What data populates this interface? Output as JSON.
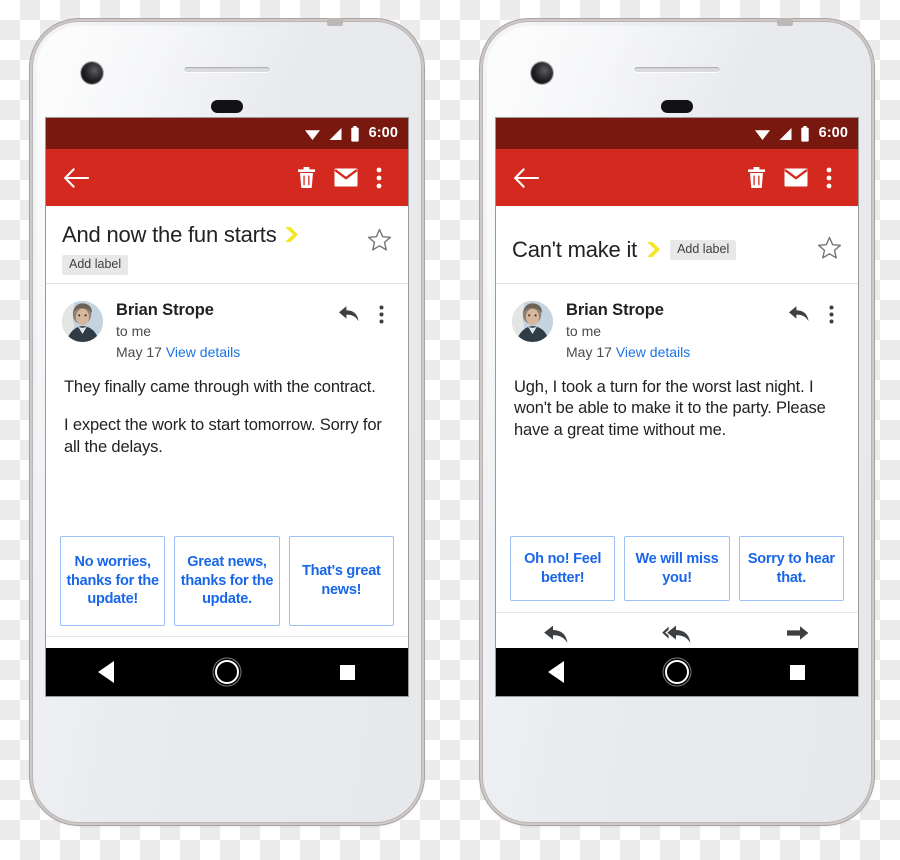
{
  "statusbar": {
    "time": "6:00",
    "icons": [
      "wifi-icon",
      "cellular-signal-icon",
      "battery-icon"
    ]
  },
  "toolbar": {
    "back_label": "Back",
    "delete_label": "Delete",
    "mark_unread_label": "Mark as unread",
    "overflow_label": "More options",
    "icons": [
      "arrow-back-icon",
      "trash-icon",
      "envelope-icon",
      "overflow-menu-icon"
    ],
    "background_color": "#d4291f",
    "statusbar_color": "#79180f"
  },
  "common": {
    "add_label": "Add label",
    "sender_name": "Brian Strope",
    "recipient": "to me",
    "date": "May 17",
    "view_details": "View details",
    "star_label": "Star",
    "reply_label": "Reply",
    "reply_all_label": "Reply all",
    "forward_label": "Forward",
    "nav_back_label": "Back",
    "nav_home_label": "Home",
    "nav_recent_label": "Recent apps",
    "link_color": "#1a73e8",
    "chip_color": "#1967e8",
    "chip_border_color": "#9cc0f7",
    "important_marker_color": "#f5e625"
  },
  "phones": [
    {
      "subject": "And now the fun starts",
      "label_layout": "stacked",
      "body": [
        "They finally came through with the contract.",
        "I expect the work to start tomorrow. Sorry for all the delays."
      ],
      "smart_replies": [
        "No worries, thanks for the update!",
        "Great news, thanks for the update.",
        "That's great news!"
      ]
    },
    {
      "subject": "Can't make it",
      "label_layout": "inline",
      "body": [
        "Ugh, I took a turn for the worst last night. I won't be able to make it to the party. Please have a great time without me."
      ],
      "smart_replies": [
        "Oh no! Feel better!",
        "We will miss you!",
        "Sorry to hear that."
      ]
    }
  ]
}
